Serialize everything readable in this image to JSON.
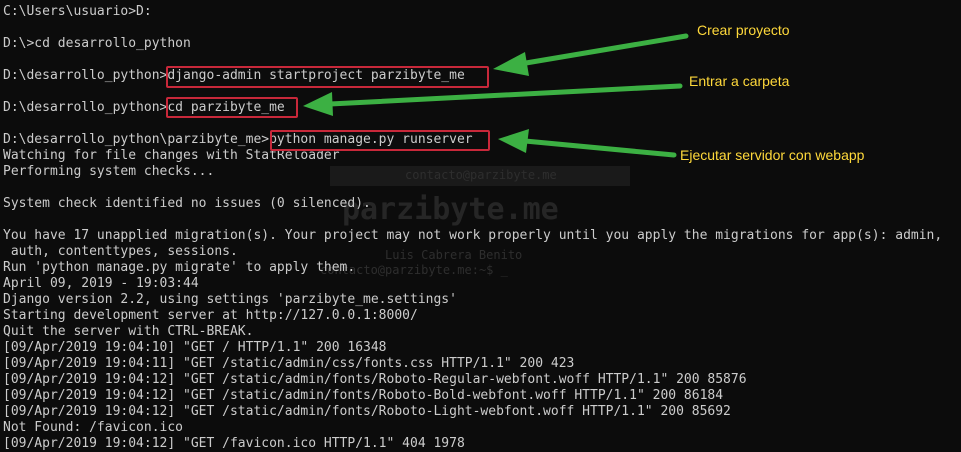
{
  "terminal": {
    "lines": [
      "C:\\Users\\usuario>D:",
      "",
      "D:\\>cd desarrollo_python",
      "",
      "D:\\desarrollo_python>django-admin startproject parzibyte_me",
      "",
      "D:\\desarrollo_python>cd parzibyte_me",
      "",
      "D:\\desarrollo_python\\parzibyte_me>python manage.py runserver",
      "Watching for file changes with StatReloader",
      "Performing system checks...",
      "",
      "System check identified no issues (0 silenced).",
      "",
      "You have 17 unapplied migration(s). Your project may not work properly until you apply the migrations for app(s): admin,",
      " auth, contenttypes, sessions.",
      "Run 'python manage.py migrate' to apply them.",
      "April 09, 2019 - 19:03:44",
      "Django version 2.2, using settings 'parzibyte_me.settings'",
      "Starting development server at http://127.0.0.1:8000/",
      "Quit the server with CTRL-BREAK.",
      "[09/Apr/2019 19:04:10] \"GET / HTTP/1.1\" 200 16348",
      "[09/Apr/2019 19:04:11] \"GET /static/admin/css/fonts.css HTTP/1.1\" 200 423",
      "[09/Apr/2019 19:04:12] \"GET /static/admin/fonts/Roboto-Regular-webfont.woff HTTP/1.1\" 200 85876",
      "[09/Apr/2019 19:04:12] \"GET /static/admin/fonts/Roboto-Bold-webfont.woff HTTP/1.1\" 200 86184",
      "[09/Apr/2019 19:04:12] \"GET /static/admin/fonts/Roboto-Light-webfont.woff HTTP/1.1\" 200 85692",
      "Not Found: /favicon.ico",
      "[09/Apr/2019 19:04:12] \"GET /favicon.ico HTTP/1.1\" 404 1978"
    ]
  },
  "watermark": {
    "email": "contacto@parzibyte.me",
    "brand": "parzibyte.me",
    "author": "Luis Cabrera Benito",
    "prompt": "contacto@parzibyte.me:~$ _"
  },
  "annotations": {
    "create_project": "Crear proyecto",
    "enter_folder": "Entrar a carpeta",
    "run_server": "Ejecutar servidor con webapp"
  },
  "colors": {
    "background": "#0c0c0c",
    "text": "#cccccc",
    "highlight": "#c8283a",
    "arrow": "#3cb043",
    "annotation": "#ffd93b"
  }
}
